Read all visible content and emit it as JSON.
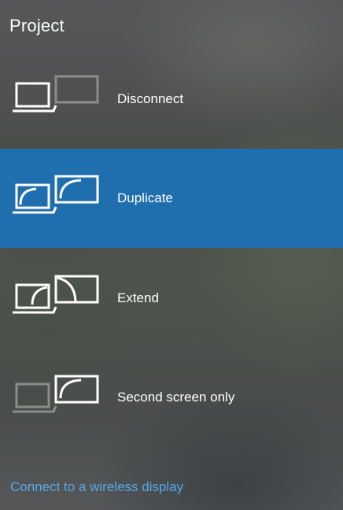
{
  "panel": {
    "title": "Project",
    "options": [
      {
        "label": "Disconnect",
        "icon": "disconnect-display-icon",
        "selected": false
      },
      {
        "label": "Duplicate",
        "icon": "duplicate-display-icon",
        "selected": true
      },
      {
        "label": "Extend",
        "icon": "extend-display-icon",
        "selected": false
      },
      {
        "label": "Second screen only",
        "icon": "second-screen-only-icon",
        "selected": false
      }
    ],
    "wireless_link": "Connect to a wireless display"
  },
  "colors": {
    "selected_background": "#1f6ead",
    "link": "#57a8e8",
    "icon_active": "#ffffff",
    "icon_inactive": "#8a8d8a"
  }
}
